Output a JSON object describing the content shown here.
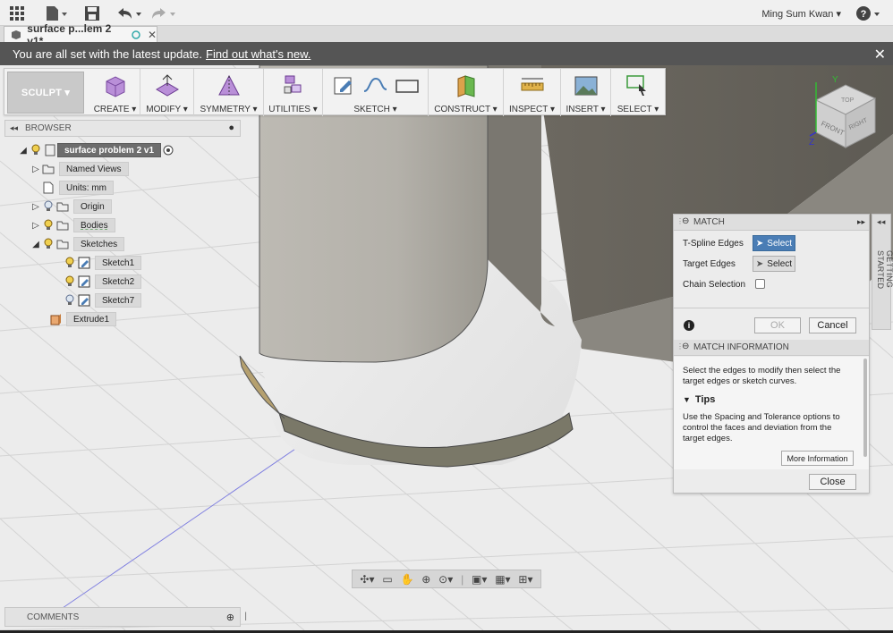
{
  "topbar": {
    "user": "Ming Sum Kwan ▾",
    "help": "? ▾"
  },
  "tab": {
    "title": "surface p...lem 2 v1*",
    "close": "✕"
  },
  "banner": {
    "text": "You are all set with the latest update.",
    "link": "Find out what's new."
  },
  "toolbar": {
    "sculpt": "SCULPT ▾",
    "groups": [
      "CREATE ▾",
      "MODIFY ▾",
      "SYMMETRY ▾",
      "UTILITIES ▾",
      "SKETCH ▾",
      "CONSTRUCT ▾",
      "INSPECT ▾",
      "INSERT ▾",
      "SELECT ▾"
    ]
  },
  "browser": {
    "title": "BROWSER",
    "root": "surface problem 2 v1",
    "nodes": [
      "Named Views",
      "Units: mm",
      "Origin",
      "Bodies",
      "Sketches",
      "Sketch1",
      "Sketch2",
      "Sketch7",
      "Extrude1"
    ]
  },
  "comments": {
    "title": "COMMENTS"
  },
  "match": {
    "title": "MATCH",
    "tspline_label": "T-Spline Edges",
    "target_label": "Target Edges",
    "chain_label": "Chain Selection",
    "select": "Select",
    "ok": "OK",
    "cancel": "Cancel",
    "info_title": "MATCH INFORMATION",
    "info_text": "Select the edges to modify then select the target edges or sketch curves.",
    "tips_title": "Tips",
    "tips_text": "Use the Spacing and Tolerance options to control the faces and deviation from the target edges.",
    "more": "More Information",
    "close": "Close"
  },
  "getting_started": "GETTING STARTED",
  "viewcube": {
    "top": "TOP",
    "front": "FRONT",
    "right": "RIGHT",
    "y": "Y",
    "z": "Z"
  },
  "colors": {
    "accent": "#4a7db5",
    "banner": "#555555",
    "surface": "#6f6b62"
  }
}
